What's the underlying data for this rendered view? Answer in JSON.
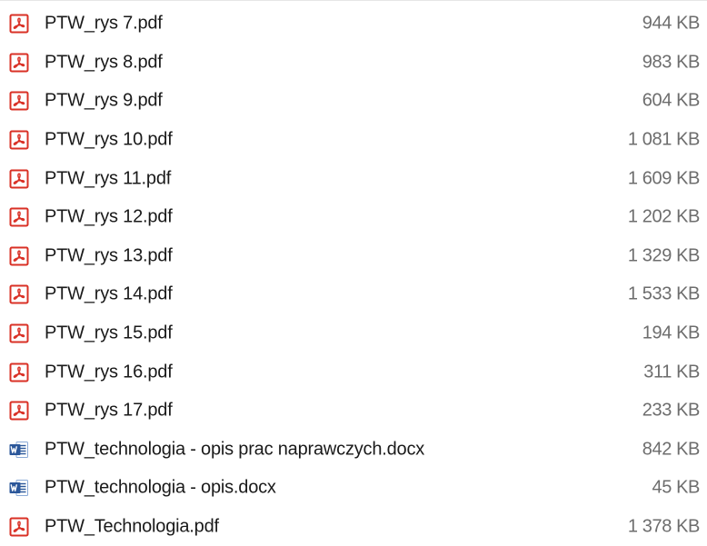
{
  "colors": {
    "pdf_icon": "#d93025",
    "word_icon": "#2b579a",
    "size_text": "#6d6d6d"
  },
  "files": [
    {
      "name": "PTW_rys 7.pdf",
      "size": "944 KB",
      "icon": "pdf-icon"
    },
    {
      "name": "PTW_rys 8.pdf",
      "size": "983 KB",
      "icon": "pdf-icon"
    },
    {
      "name": "PTW_rys 9.pdf",
      "size": "604 KB",
      "icon": "pdf-icon"
    },
    {
      "name": "PTW_rys 10.pdf",
      "size": "1 081 KB",
      "icon": "pdf-icon"
    },
    {
      "name": "PTW_rys 11.pdf",
      "size": "1 609 KB",
      "icon": "pdf-icon"
    },
    {
      "name": "PTW_rys 12.pdf",
      "size": "1 202 KB",
      "icon": "pdf-icon"
    },
    {
      "name": "PTW_rys 13.pdf",
      "size": "1 329 KB",
      "icon": "pdf-icon"
    },
    {
      "name": "PTW_rys 14.pdf",
      "size": "1 533 KB",
      "icon": "pdf-icon"
    },
    {
      "name": "PTW_rys 15.pdf",
      "size": "194 KB",
      "icon": "pdf-icon"
    },
    {
      "name": "PTW_rys 16.pdf",
      "size": "311 KB",
      "icon": "pdf-icon"
    },
    {
      "name": "PTW_rys 17.pdf",
      "size": "233 KB",
      "icon": "pdf-icon"
    },
    {
      "name": "PTW_technologia - opis prac naprawczych.docx",
      "size": "842 KB",
      "icon": "word-icon"
    },
    {
      "name": "PTW_technologia - opis.docx",
      "size": "45 KB",
      "icon": "word-icon"
    },
    {
      "name": "PTW_Technologia.pdf",
      "size": "1 378 KB",
      "icon": "pdf-icon"
    }
  ]
}
